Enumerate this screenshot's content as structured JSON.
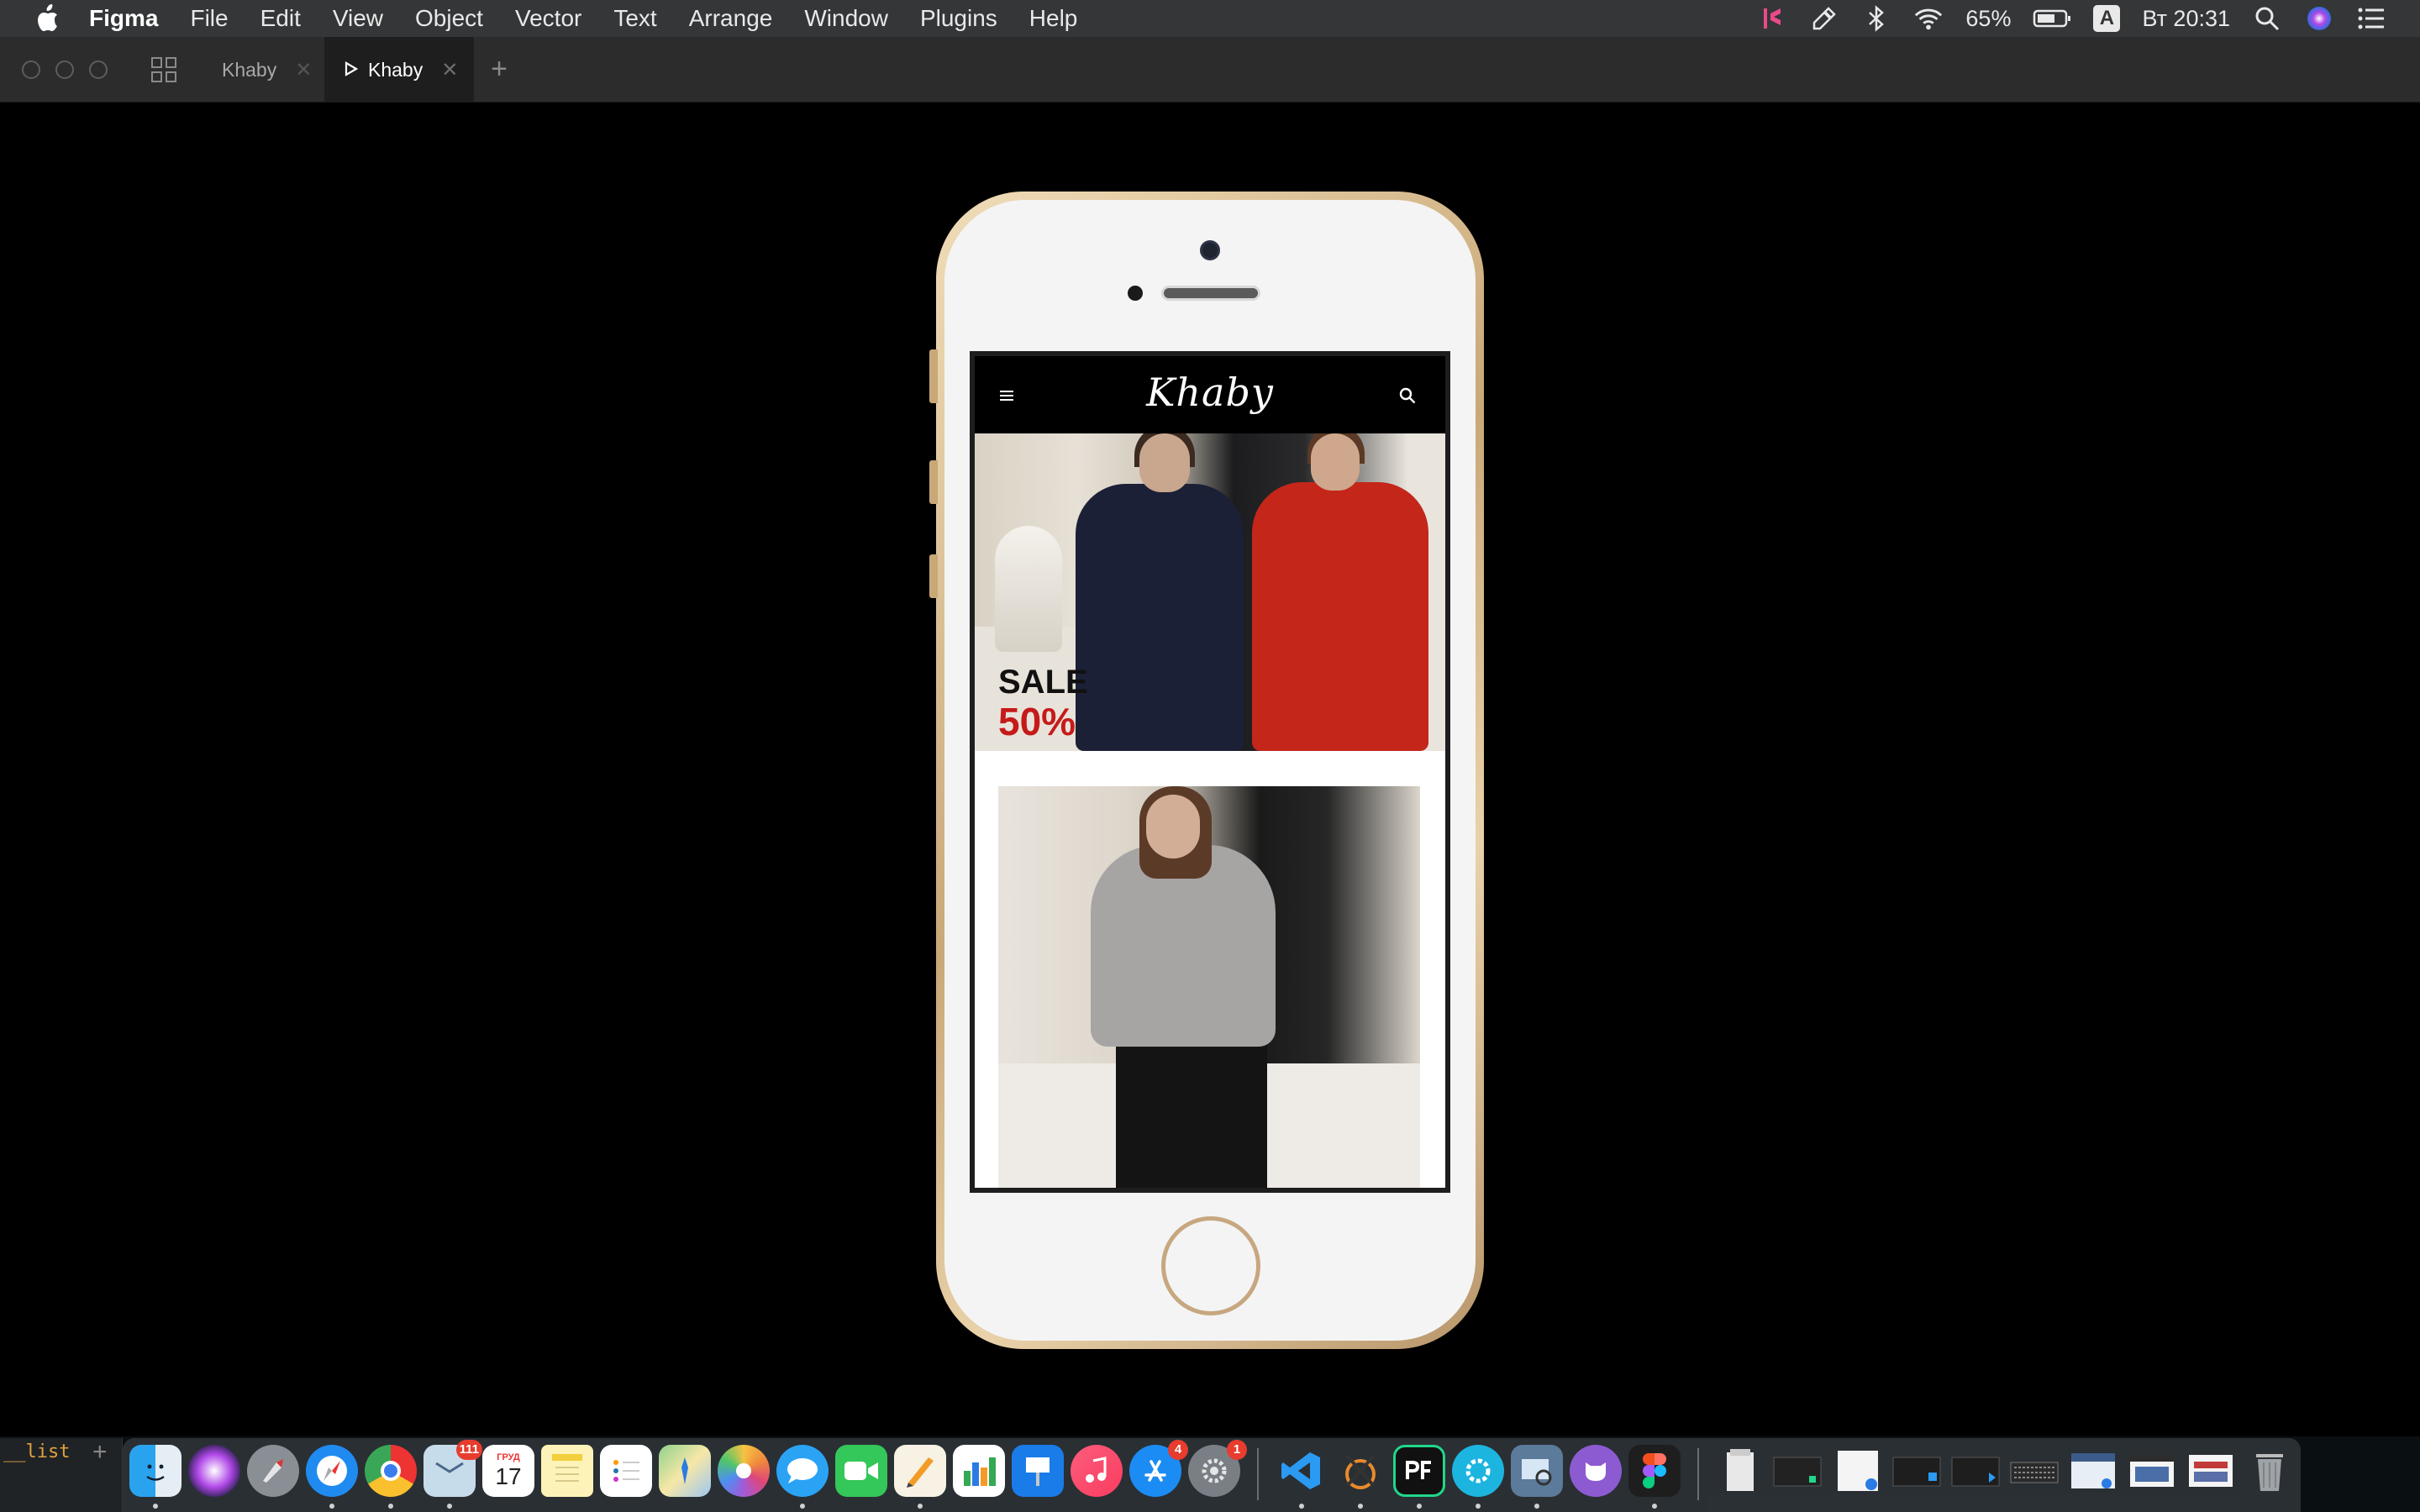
{
  "menubar": {
    "app_name": "Figma",
    "items": [
      "File",
      "Edit",
      "View",
      "Object",
      "Vector",
      "Text",
      "Arrange",
      "Window",
      "Plugins",
      "Help"
    ],
    "battery": "65%",
    "input_source": "A",
    "clock": "Вт 20:31"
  },
  "tabs": {
    "tab1_label": "Khaby",
    "tab2_label": "Khaby",
    "close_glyph": "✕",
    "add_glyph": "+"
  },
  "app": {
    "logo": "Khaby",
    "sale_label": "SALE",
    "sale_percent": "50%"
  },
  "terminal": {
    "text": "__list"
  },
  "dock": {
    "mail_badge": "111",
    "calendar_month": "ГРУД",
    "calendar_day": "17",
    "appstore_badge": "4",
    "prefs_badge": "1"
  },
  "colors": {
    "menubar_bg": "#343638",
    "tabbar_bg": "#2c2c2c",
    "sale_red": "#c61a1a",
    "phone_gold": "#c9a878"
  }
}
